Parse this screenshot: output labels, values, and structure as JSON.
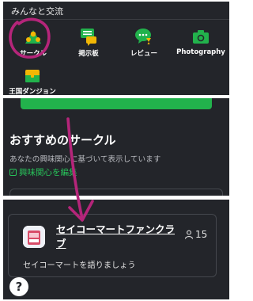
{
  "top_panel": {
    "section_title": "みんなと交流",
    "apps": [
      {
        "label": "サークル",
        "icon": "circle-people-icon"
      },
      {
        "label": "掲示板",
        "icon": "bulletin-board-icon"
      },
      {
        "label": "レビュー",
        "icon": "review-chat-icon"
      },
      {
        "label": "Photography",
        "icon": "camera-icon"
      },
      {
        "label": "王国ダンジョン",
        "icon": "treasure-chest-icon"
      }
    ]
  },
  "recommend": {
    "title": "おすすめのサークル",
    "description": "あなたの興味関心に基づいて表示しています",
    "edit_link": "興味関心を編集"
  },
  "circle_card": {
    "name": "セイコーマートファンクラブ",
    "member_count": "15",
    "description": "セイコーマートを語りましょう"
  },
  "help": {
    "label": "?"
  },
  "colors": {
    "panel_bg": "#23252a",
    "accent_green": "#22b24c",
    "annotation_magenta": "#b5257a"
  }
}
